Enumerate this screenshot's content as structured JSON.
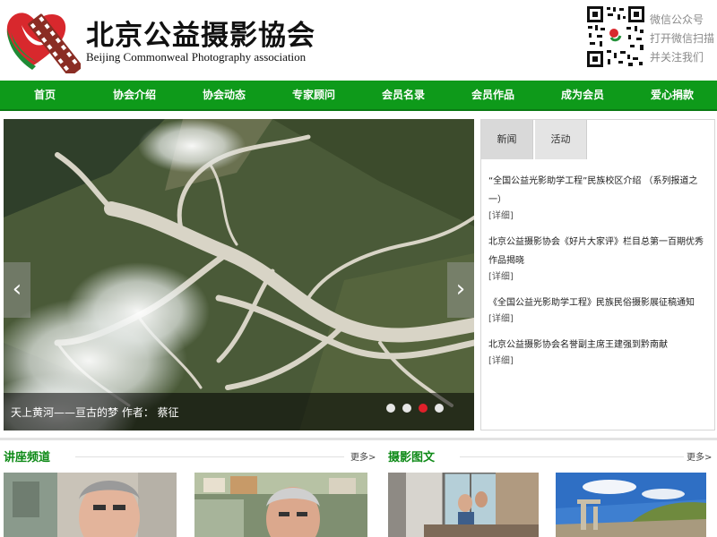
{
  "header": {
    "brand_cn": "北京公益摄影協会",
    "brand_en": "Beijing Commonweal Photography association",
    "qr_lines": [
      "微信公众号",
      "打开微信扫描",
      "并关注我们"
    ]
  },
  "nav": {
    "items": [
      "首页",
      "协会介绍",
      "协会动态",
      "专家顾问",
      "会员名录",
      "会员作品",
      "成为会员",
      "爱心捐款"
    ]
  },
  "hero": {
    "caption": "天上黄河——亘古的梦 作者： 蔡征",
    "prev_arrow": "‹",
    "next_arrow": "›",
    "slide_count": 4,
    "active_slide": 3
  },
  "news": {
    "tabs": [
      "新闻",
      "活动"
    ],
    "active_tab": "新闻",
    "more_label": "[详细]",
    "items": [
      {
        "title": "“全国公益光影助学工程”民族校区介绍 （系列报道之一）"
      },
      {
        "title": "北京公益摄影协会《好片大家评》栏目总第一百期优秀作品揭晓"
      },
      {
        "title": "《全国公益光影助学工程》民族民俗摄影展征稿通知"
      },
      {
        "title": "北京公益摄影协会名誉副主席王建强到黔南献"
      }
    ]
  },
  "sections": {
    "lecture": {
      "title": "讲座频道",
      "more": "更多>"
    },
    "photo": {
      "title": "摄影图文",
      "more": "更多>"
    }
  },
  "colors": {
    "nav_green": "#0e9a1a",
    "section_green": "#0e8a17",
    "active_dot": "#e0202a"
  }
}
